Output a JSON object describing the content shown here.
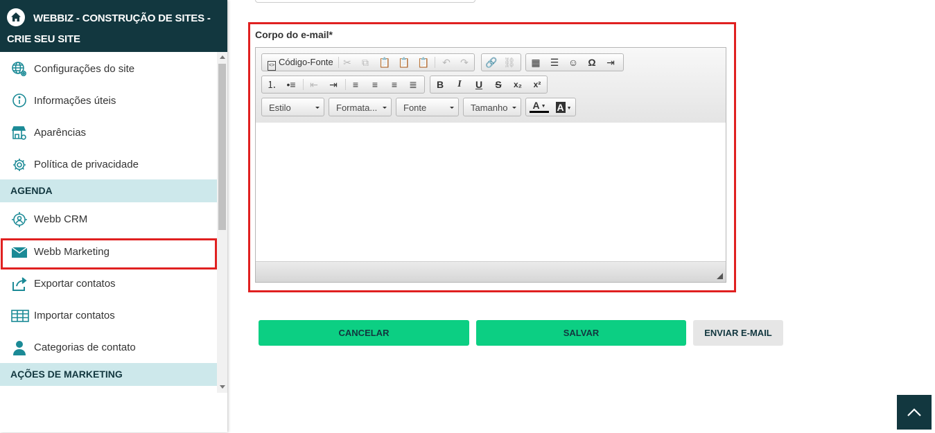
{
  "sidebar": {
    "header_title": "WEBBIZ - CONSTRUÇÃO DE SITES - CRIE SEU SITE",
    "items": [
      {
        "label": "Configurações do site",
        "icon": "globe-gear-icon"
      },
      {
        "label": "Informações úteis",
        "icon": "info-icon"
      },
      {
        "label": "Aparências",
        "icon": "store-icon"
      },
      {
        "label": "Política de privacidade",
        "icon": "gear-icon"
      }
    ],
    "section_agenda": "AGENDA",
    "agenda_items": [
      {
        "label": "Webb CRM",
        "icon": "crm-target-icon"
      },
      {
        "label": "Webb Marketing",
        "icon": "envelope-icon"
      },
      {
        "label": "Exportar contatos",
        "icon": "export-icon"
      },
      {
        "label": "Importar contatos",
        "icon": "table-icon"
      },
      {
        "label": "Categorias de contato",
        "icon": "user-icon"
      }
    ],
    "section_marketing": "AÇÕES DE MARKETING"
  },
  "form": {
    "body_label": "Corpo do e-mail*",
    "body_value": ""
  },
  "editor": {
    "source_label": "Código-Fonte",
    "combos": {
      "style": "Estilo",
      "format": "Formata...",
      "font": "Fonte",
      "size": "Tamanho"
    },
    "text_color_glyph": "A",
    "bg_color_glyph": "A"
  },
  "buttons": {
    "cancel": "CANCELAR",
    "save": "SALVAR",
    "send_email": "ENVIAR E-MAIL"
  },
  "colors": {
    "header_bg": "#12373f",
    "section_bg": "#cde8eb",
    "accent_green": "#0ccf83",
    "highlight_red": "#e02020",
    "icon_teal": "#1b8a96"
  }
}
